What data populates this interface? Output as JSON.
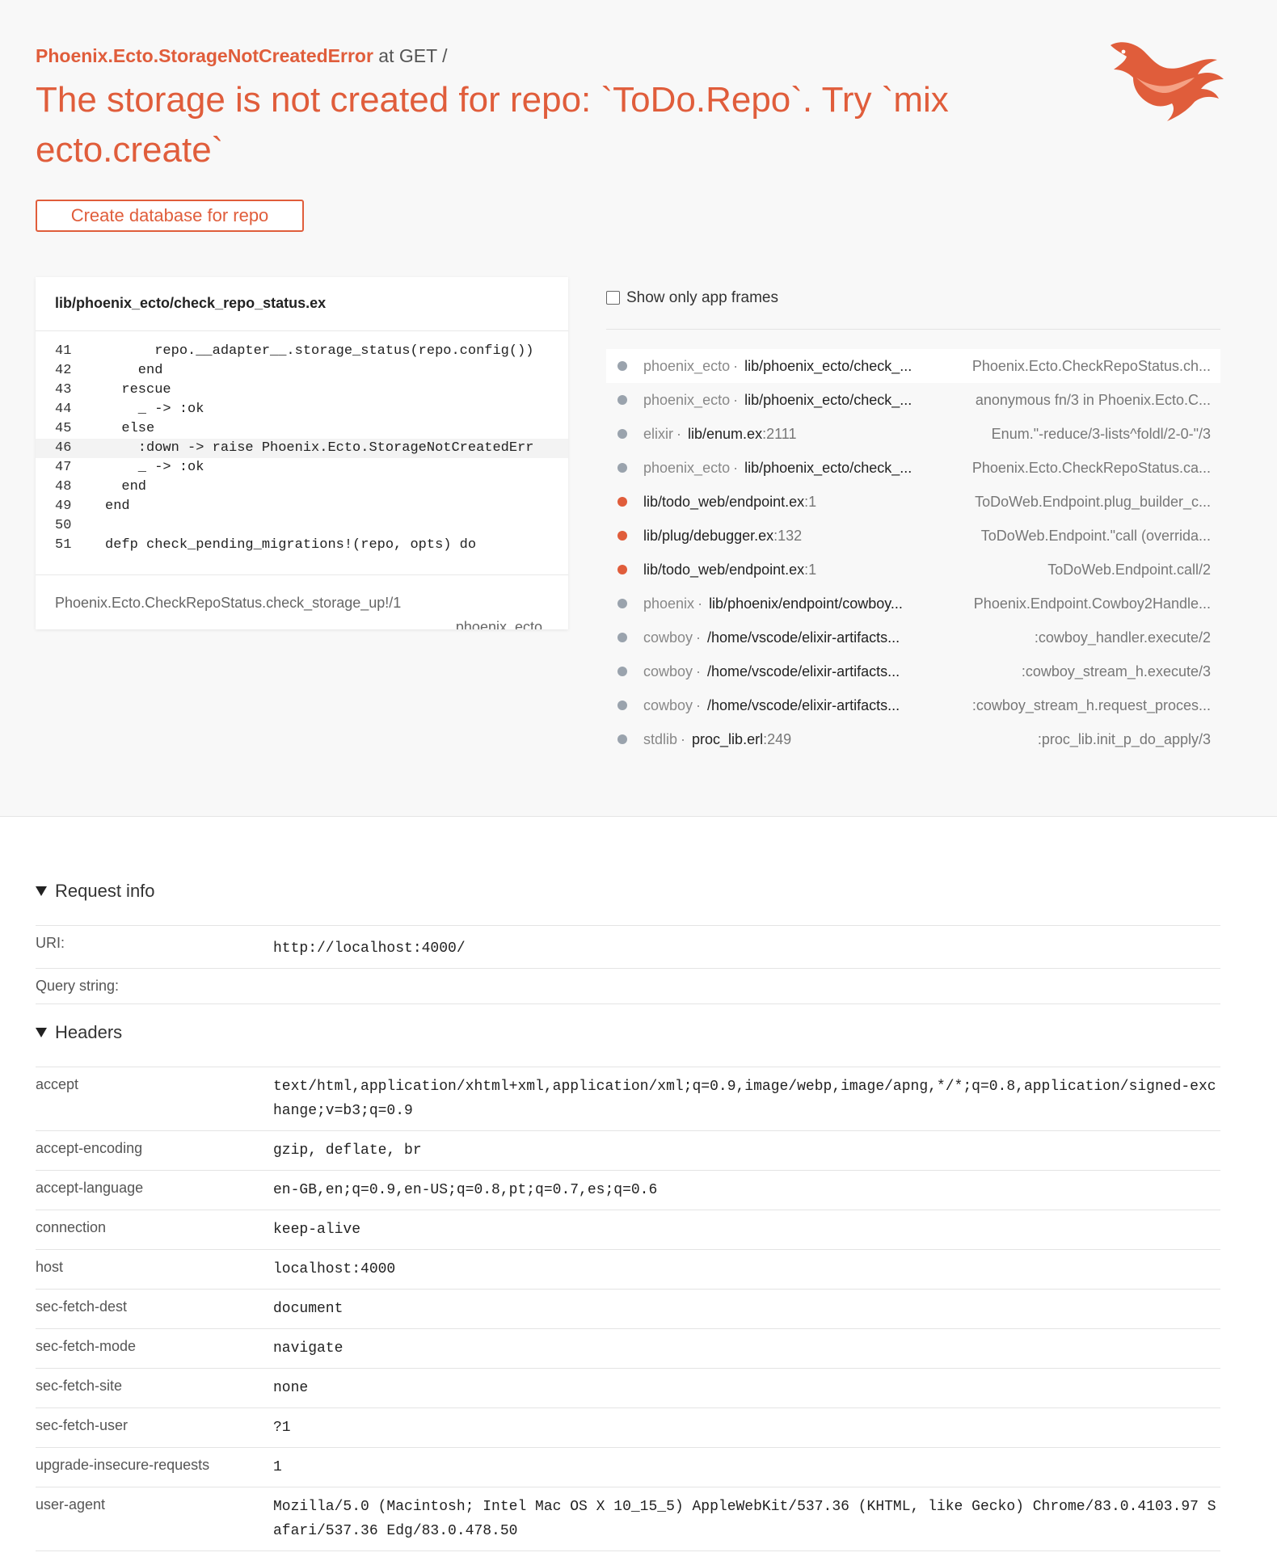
{
  "error": {
    "exception": "Phoenix.Ecto.StorageNotCreatedError",
    "at_text": " at GET /",
    "message": "The storage is not created for repo: `ToDo.Repo`. Try `mix ecto.create`",
    "action_label": "Create database for repo"
  },
  "code": {
    "file": "lib/phoenix_ecto/check_repo_status.ex",
    "lines": [
      {
        "n": "41",
        "src": "      repo.__adapter__.storage_status(repo.config())"
      },
      {
        "n": "42",
        "src": "    end"
      },
      {
        "n": "43",
        "src": "  rescue"
      },
      {
        "n": "44",
        "src": "    _ -> :ok"
      },
      {
        "n": "45",
        "src": "  else"
      },
      {
        "n": "46",
        "src": "    :down -> raise Phoenix.Ecto.StorageNotCreatedErr"
      },
      {
        "n": "47",
        "src": "    _ -> :ok"
      },
      {
        "n": "48",
        "src": "  end"
      },
      {
        "n": "49",
        "src": "end"
      },
      {
        "n": "50",
        "src": ""
      },
      {
        "n": "51",
        "src": "defp check_pending_migrations!(repo, opts) do"
      }
    ],
    "function": "Phoenix.Ecto.CheckRepoStatus.check_storage_up!/1",
    "app": "phoenix_ecto"
  },
  "frames": {
    "toggle_label": "Show only app frames",
    "items": [
      {
        "app": "phoenix_ecto",
        "file": "lib/phoenix_ecto/check_...",
        "line": "",
        "func": "Phoenix.Ecto.CheckRepoStatus.ch...",
        "is_app": false
      },
      {
        "app": "phoenix_ecto",
        "file": "lib/phoenix_ecto/check_...",
        "line": "",
        "func": "anonymous fn/3 in Phoenix.Ecto.C...",
        "is_app": false
      },
      {
        "app": "elixir",
        "file": "lib/enum.ex",
        "line": ":2111",
        "func": "Enum.\"-reduce/3-lists^foldl/2-0-\"/3",
        "is_app": false
      },
      {
        "app": "phoenix_ecto",
        "file": "lib/phoenix_ecto/check_...",
        "line": "",
        "func": "Phoenix.Ecto.CheckRepoStatus.ca...",
        "is_app": false
      },
      {
        "app": "",
        "file": "lib/todo_web/endpoint.ex",
        "line": ":1",
        "func": "ToDoWeb.Endpoint.plug_builder_c...",
        "is_app": true
      },
      {
        "app": "",
        "file": "lib/plug/debugger.ex",
        "line": ":132",
        "func": "ToDoWeb.Endpoint.\"call (overrida...",
        "is_app": true
      },
      {
        "app": "",
        "file": "lib/todo_web/endpoint.ex",
        "line": ":1",
        "func": "ToDoWeb.Endpoint.call/2",
        "is_app": true
      },
      {
        "app": "phoenix",
        "file": "lib/phoenix/endpoint/cowboy...",
        "line": "",
        "func": "Phoenix.Endpoint.Cowboy2Handle...",
        "is_app": false
      },
      {
        "app": "cowboy",
        "file": "/home/vscode/elixir-artifacts...",
        "line": "",
        "func": ":cowboy_handler.execute/2",
        "is_app": false
      },
      {
        "app": "cowboy",
        "file": "/home/vscode/elixir-artifacts...",
        "line": "",
        "func": ":cowboy_stream_h.execute/3",
        "is_app": false
      },
      {
        "app": "cowboy",
        "file": "/home/vscode/elixir-artifacts...",
        "line": "",
        "func": ":cowboy_stream_h.request_proces...",
        "is_app": false
      },
      {
        "app": "stdlib",
        "file": "proc_lib.erl",
        "line": ":249",
        "func": ":proc_lib.init_p_do_apply/3",
        "is_app": false
      }
    ]
  },
  "request_info": {
    "title": "Request info",
    "rows": [
      {
        "k": "URI:",
        "v": "http://localhost:4000/"
      },
      {
        "k": "Query string:",
        "v": ""
      }
    ]
  },
  "headers": {
    "title": "Headers",
    "rows": [
      {
        "k": "accept",
        "v": "text/html,application/xhtml+xml,application/xml;q=0.9,image/webp,image/apng,*/*;q=0.8,application/signed-exchange;v=b3;q=0.9"
      },
      {
        "k": "accept-encoding",
        "v": "gzip, deflate, br"
      },
      {
        "k": "accept-language",
        "v": "en-GB,en;q=0.9,en-US;q=0.8,pt;q=0.7,es;q=0.6"
      },
      {
        "k": "connection",
        "v": "keep-alive"
      },
      {
        "k": "host",
        "v": "localhost:4000"
      },
      {
        "k": "sec-fetch-dest",
        "v": "document"
      },
      {
        "k": "sec-fetch-mode",
        "v": "navigate"
      },
      {
        "k": "sec-fetch-site",
        "v": "none"
      },
      {
        "k": "sec-fetch-user",
        "v": "?1"
      },
      {
        "k": "upgrade-insecure-requests",
        "v": "1"
      },
      {
        "k": "user-agent",
        "v": "Mozilla/5.0 (Macintosh; Intel Mac OS X 10_15_5) AppleWebKit/537.36 (KHTML, like Gecko) Chrome/83.0.4103.97 Safari/537.36 Edg/83.0.478.50"
      }
    ]
  },
  "icons": {
    "logo": "phoenix-logo-icon",
    "checkbox": "checkbox-icon",
    "section_toggle": "triangle-down-icon"
  },
  "colors": {
    "accent": "#e05d3b",
    "app_frame_dot": "#e05d3b",
    "lib_frame_dot": "#9aa3ad"
  }
}
